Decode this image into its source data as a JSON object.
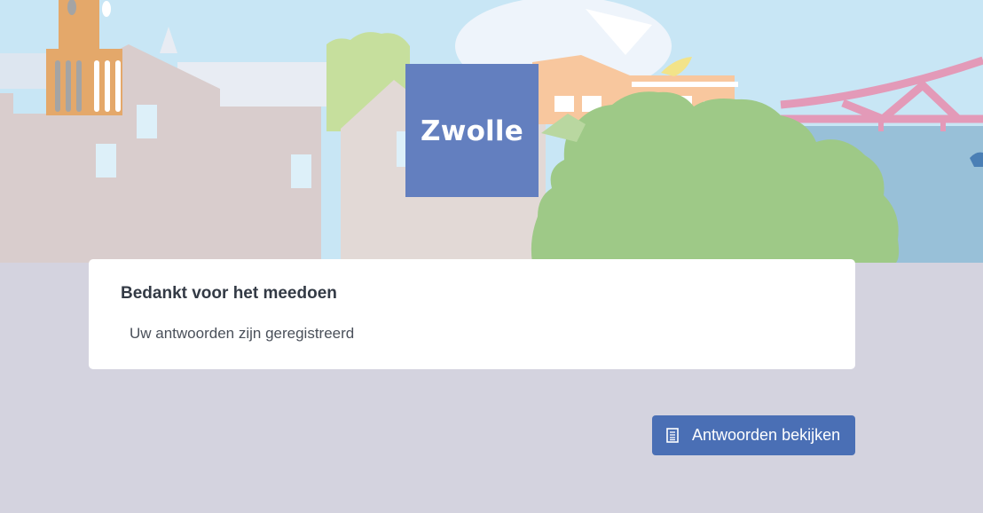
{
  "header": {
    "logo_text": "Zwolle",
    "logo_color": "#637fbf"
  },
  "card": {
    "title": "Bedankt voor het meedoen",
    "message": "Uw antwoorden zijn geregistreerd"
  },
  "actions": {
    "view_answers_label": "Antwoorden bekijken",
    "view_answers_icon": "document-icon",
    "button_color": "#4a6fb5"
  },
  "colors": {
    "background": "#d4d3df",
    "card": "#ffffff",
    "sky": "#c8e6f5"
  }
}
